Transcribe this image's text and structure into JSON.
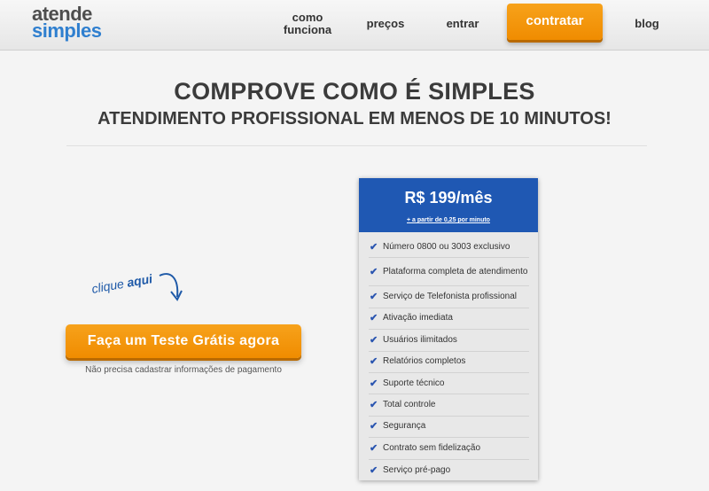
{
  "header": {
    "logo_line1": "atende",
    "logo_line2": "simples",
    "nav": {
      "como_funciona_line1": "como",
      "como_funciona_line2": "funciona",
      "precos": "preços",
      "entrar": "entrar",
      "contratar": "contratar",
      "blog": "blog"
    },
    "accent_color": "#f08c00",
    "brand_blue": "#2f7fcf"
  },
  "hero": {
    "title": "COMPROVE COMO É SIMPLES",
    "subtitle": "ATENDIMENTO PROFISSIONAL EM MENOS DE 10 MINUTOS!"
  },
  "cta": {
    "clique": "clique",
    "aqui": "aqui",
    "arrow_icon": "curved-arrow-down-icon",
    "button_label": "Faça um Teste Grátis agora",
    "note": "Não precisa cadastrar informações de pagamento"
  },
  "pricing": {
    "price": "R$ 199/mês",
    "price_note": "+ a partir de 0,25 por minuto",
    "card_color": "#1f58b3",
    "check_icon": "checkmark-icon",
    "features": [
      "Número 0800 ou 3003 exclusivo",
      "Plataforma completa de atendimento",
      "Serviço de Telefonista profissional",
      "Ativação imediata",
      "Usuários ilimitados",
      "Relatórios completos",
      "Suporte técnico",
      "Total controle",
      "Segurança",
      "Contrato sem fidelização",
      "Serviço pré-pago"
    ]
  }
}
